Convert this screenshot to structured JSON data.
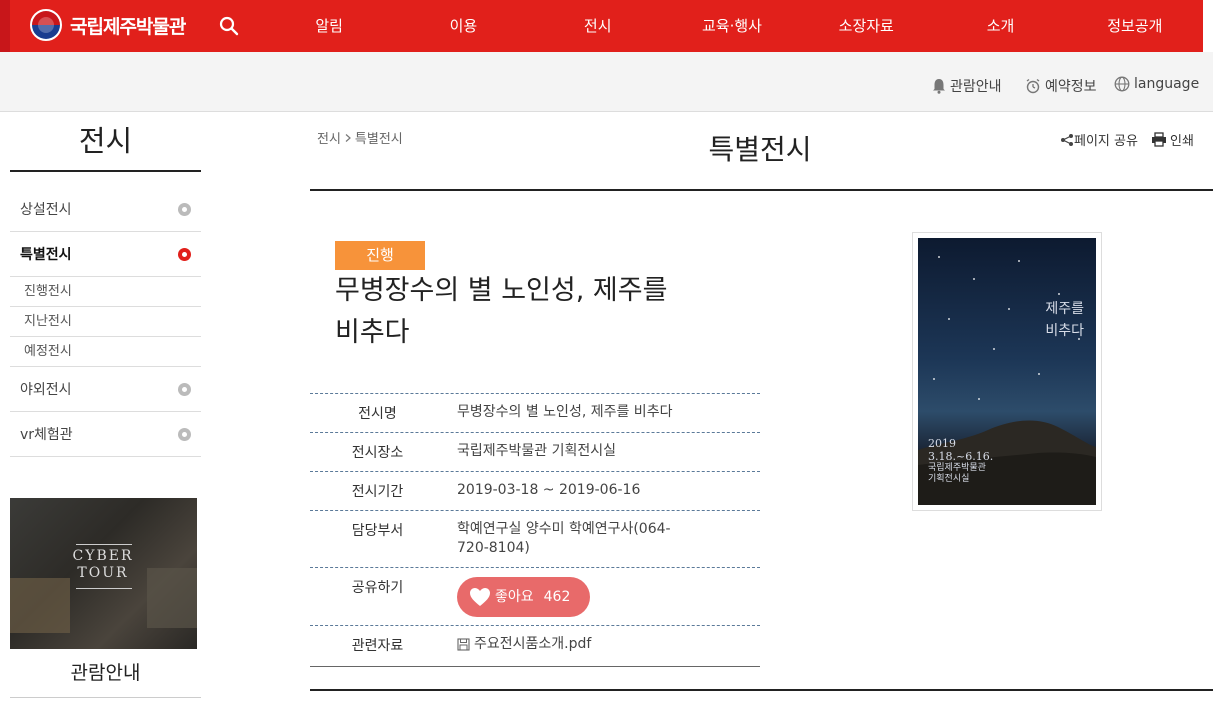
{
  "header": {
    "logo_text": "국립제주박물관",
    "nav": [
      "알림",
      "이용",
      "전시",
      "교육·행사",
      "소장자료",
      "소개",
      "정보공개"
    ]
  },
  "util": {
    "guide": "관람안내",
    "reservation": "예약정보",
    "language": "language"
  },
  "sidebar": {
    "title": "전시",
    "items": [
      {
        "label": "상설전시"
      },
      {
        "label": "특별전시"
      },
      {
        "label": "진행전시"
      },
      {
        "label": "지난전시"
      },
      {
        "label": "예정전시"
      },
      {
        "label": "야외전시"
      },
      {
        "label": "vr체험관"
      }
    ],
    "cyber_line1": "CYBER",
    "cyber_line2": "TOUR",
    "guide_label": "관람안내"
  },
  "main": {
    "breadcrumb": [
      "전시",
      "특별전시"
    ],
    "page_title": "특별전시",
    "share_label": "페이지 공유",
    "print_label": "인쇄",
    "status_badge": "진행",
    "exhibition_title_line1": "무병장수의 별 노인성, 제주를",
    "exhibition_title_line2": "비추다",
    "info": [
      {
        "label": "전시명",
        "value": "무병장수의 별 노인성, 제주를 비추다"
      },
      {
        "label": "전시장소",
        "value": "국립제주박물관 기획전시실"
      },
      {
        "label": "전시기간",
        "value": "2019-03-18 ~ 2019-06-16"
      },
      {
        "label": "담당부서",
        "value": "학예연구실 양수미 학예연구사(064-720-8104)"
      },
      {
        "label": "공유하기",
        "value": ""
      },
      {
        "label": "관련자료",
        "value": "주요전시품소개.pdf"
      }
    ],
    "like_label": "좋아요",
    "like_count": "462",
    "poster": {
      "title_line1": "제주를",
      "title_line2": "비추다",
      "date": "2019",
      "date_range": "3.18.~6.16.",
      "venue": "국립제주박물관",
      "room": "기획전시실"
    }
  },
  "colors": {
    "brand_red": "#e1201b",
    "badge_orange": "#f7933a",
    "like_pink": "#e86a6a"
  }
}
